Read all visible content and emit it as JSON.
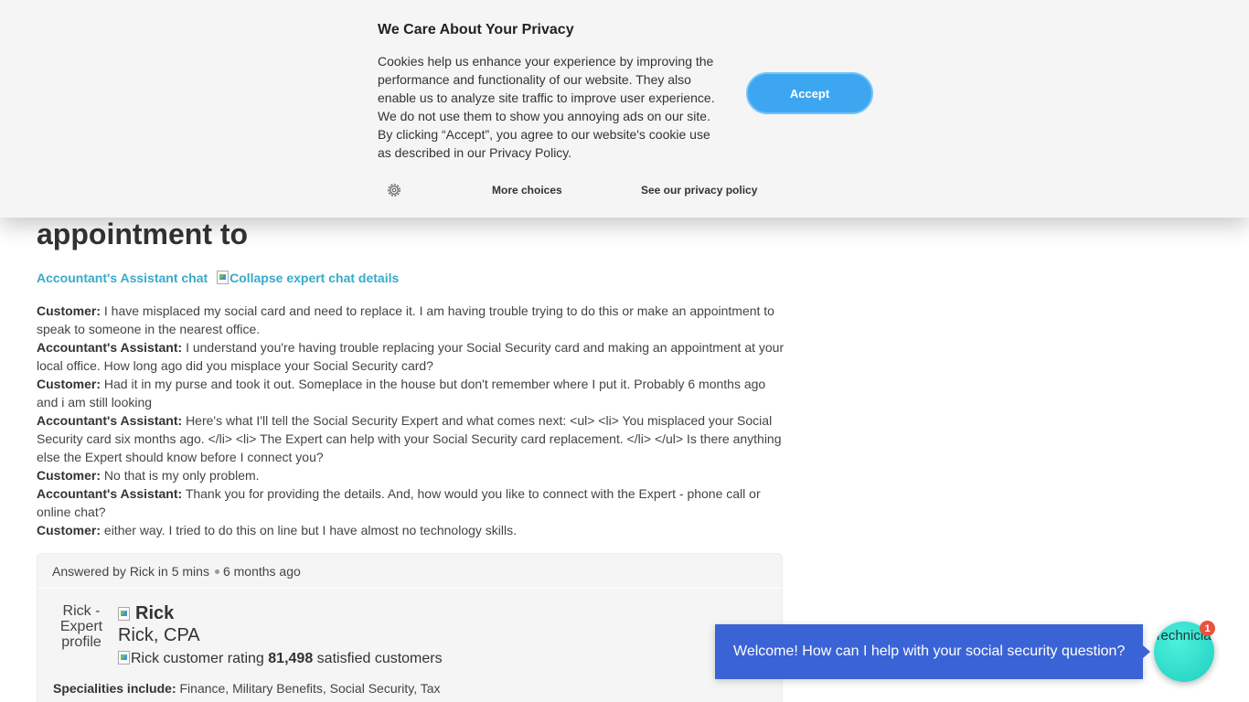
{
  "cookie_banner": {
    "title": "We Care About Your Privacy",
    "text": "Cookies help us enhance your experience by improving the performance and functionality of our website. They also enable us to analyze site traffic to improve user experience. We do not use them to show you annoying ads on our site. By clicking “Accept”, you agree to our website's cookie use as described in our Privacy Policy.",
    "accept_label": "Accept",
    "more_choices_label": "More choices",
    "privacy_policy_label": "See our privacy policy",
    "gear_icon": "gear-icon",
    "accent_color": "#3ca7f0"
  },
  "page": {
    "heading": "appointment to",
    "chat_link": "Accountant's Assistant chat",
    "collapse_alt": "Collapse expert chat details"
  },
  "transcript": [
    {
      "speaker": "Customer:",
      "text": "I have misplaced my social card and need to replace it. I am having trouble trying to do this or make an appointment to speak to someone in the nearest office."
    },
    {
      "speaker": "Accountant's Assistant:",
      "text": "I understand you're having trouble replacing your Social Security card and making an appointment at your local office. How long ago did you misplace your Social Security card?"
    },
    {
      "speaker": "Customer:",
      "text": "Had it in my purse and took it out. Someplace in the house but don't remember where I put it. Probably 6 months ago and i am still looking"
    },
    {
      "speaker": "Accountant's Assistant:",
      "text": "Here's what I'll tell the Social Security Expert and what comes next: <ul> <li> You misplaced your Social Security card six months ago. </li> <li> The Expert can help with your Social Security card replacement. </li> </ul> Is there anything else the Expert should know before I connect you?"
    },
    {
      "speaker": "Customer:",
      "text": "No that is my only problem."
    },
    {
      "speaker": "Accountant's Assistant:",
      "text": "Thank you for providing the details. And, how would you like to connect with the Expert - phone call or online chat?"
    },
    {
      "speaker": "Customer:",
      "text": "either way. I tried to do this on line but I have almost no technology skills."
    }
  ],
  "answer": {
    "answered_by": "Answered by Rick in 5 mins",
    "time_ago": "6 months ago",
    "photo_alt": "Rick - Expert profile",
    "expert_name": "Rick",
    "expert_title": "Rick, CPA",
    "rating_alt": "Rick customer rating",
    "satisfied_count": "81,498",
    "satisfied_label": "satisfied customers",
    "specialities_label": "Specialities include:",
    "specialities": "Finance, Military Benefits, Social Security, Tax"
  },
  "chat_widget": {
    "welcome": "Welcome! How can I help with your social security question?",
    "avatar_alt": "Technician Assistant",
    "badge_count": "1",
    "bubble_color": "#3a63d6"
  }
}
